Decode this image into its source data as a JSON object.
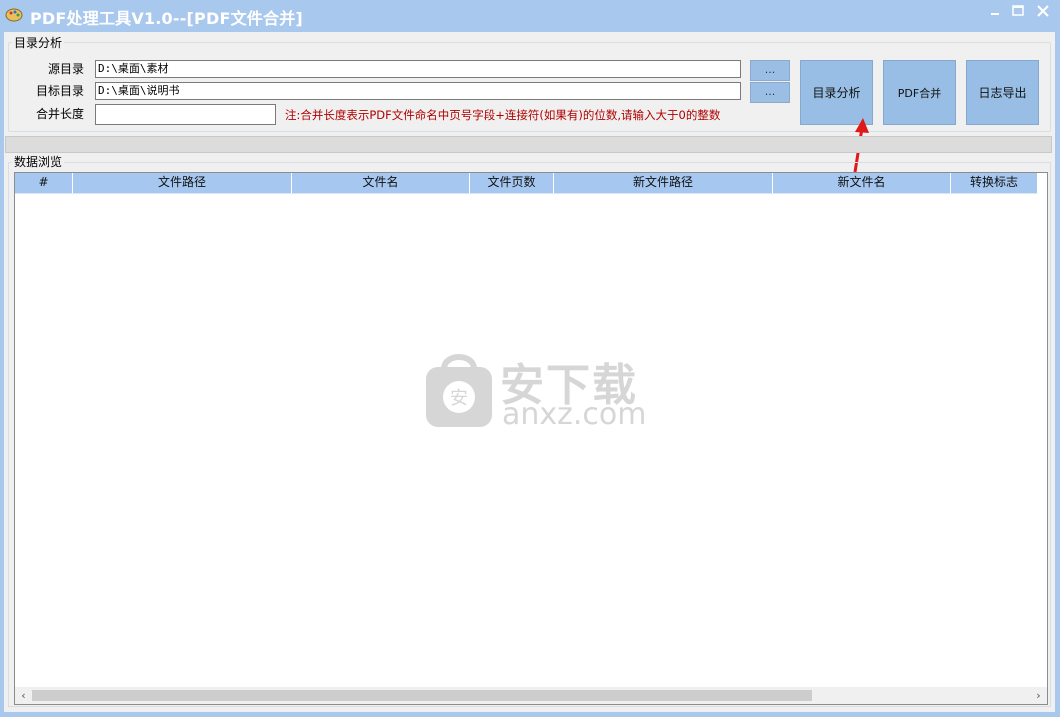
{
  "window": {
    "title": "PDF处理工具V1.0--[PDF文件合并]"
  },
  "directory_group": {
    "title": "目录分析",
    "source_label": "源目录",
    "source_value": "D:\\桌面\\素材",
    "target_label": "目标目录",
    "target_value": "D:\\桌面\\说明书",
    "merge_length_label": "合并长度",
    "merge_length_value": "",
    "browse_label": "...",
    "note": "注:合并长度表示PDF文件命名中页号字段+连接符(如果有)的位数,请输入大于0的整数"
  },
  "buttons": {
    "analyze": "目录分析",
    "merge": "PDF合并",
    "export_log": "日志导出"
  },
  "data_group": {
    "title": "数据浏览",
    "columns": [
      "#",
      "文件路径",
      "文件名",
      "文件页数",
      "新文件路径",
      "新文件名",
      "转换标志"
    ]
  },
  "watermark": {
    "brand": "安下载",
    "url": "anxz.com",
    "badge": "安"
  },
  "colors": {
    "titlebar": "#a9c8ee",
    "header": "#a6c8f0",
    "button": "#98bee5",
    "note": "#b00000",
    "arrow": "#e01818"
  }
}
